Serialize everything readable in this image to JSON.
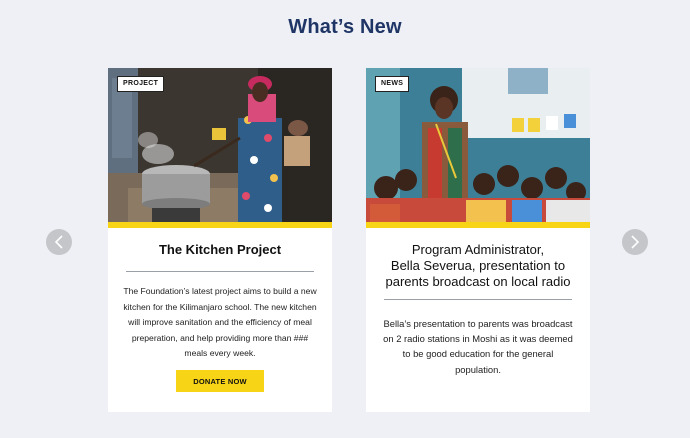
{
  "section": {
    "title": "What’s New"
  },
  "cards": [
    {
      "tag": "PROJECT",
      "title": "The Kitchen Project",
      "body": "The Foundation’s latest project aims to build a new kitchen for the Kilimanjaro school. The new kitchen will improve sanitation and the efficiency of meal preperation, and help providing more than ### meals every week.",
      "button_label": "DONATE NOW"
    },
    {
      "tag": "NEWS",
      "title_lines": [
        "Program Administrator,",
        "Bella Severua, presentation to",
        "parents broadcast on local radio"
      ],
      "body": "Bella’s presentation to parents was broadcast on 2 radio stations in Moshi as it was deemed to be good education for the general population."
    }
  ],
  "carousel": {
    "prev_icon": "chevron-left-icon",
    "next_icon": "chevron-right-icon"
  },
  "colors": {
    "accent": "#f7d416",
    "title": "#1f3566",
    "background": "#eef0f5",
    "arrow": "#c4c6ca"
  }
}
